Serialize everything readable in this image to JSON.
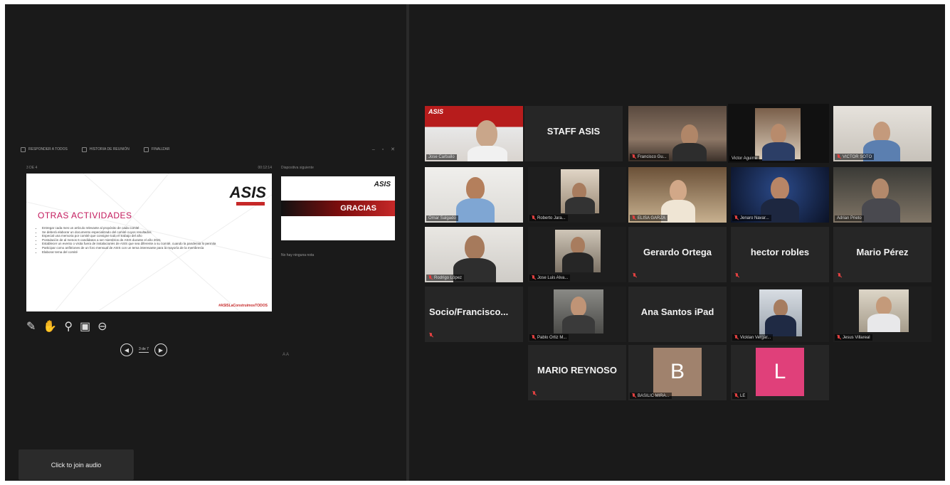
{
  "toolbar": {
    "items": [
      "RESPONDER A TODOS",
      "HISTORIA DE REUNIÓN",
      "FINALIZAR"
    ]
  },
  "slide_panel": {
    "counter": "3 DE 4",
    "timer": "00:12:14",
    "next_label": "Diapositiva siguiente",
    "notes": "No hay ninguna nota",
    "nav_count": "3 de 7"
  },
  "current_slide": {
    "logo": "ASIS",
    "title": "OTRAS ACTIVIDADES",
    "bullets": [
      "Entregar cada mes un artículo relevante al propósito de cada comité",
      "Se deberá elaborar un documento especializado del comité cuyos resultados",
      "Especial una memoria por comité que consigne todo el trabajo del año",
      "Postulación de al menos 6 candidatos a ser miembros de ASIS durante el año 2021",
      "Establecer un evento o visita fuera de instalaciones de ASIS que sea diferente a su comité, cuando la pandemia lo permita",
      "Participar como anfitriones de un foro mensual de ASIS con un tema interesante para la mayoría de la membresía",
      "Elaborar tema del comité"
    ],
    "hashtag": "#ASISLaConstruimosTODOS"
  },
  "next_slide": {
    "logo": "ASIS",
    "title": "GRACIAS"
  },
  "join_audio": "Click to join audio",
  "participants": [
    {
      "name": "Jose Carballo",
      "type": "video"
    },
    {
      "name": "STAFF ASIS",
      "type": "name"
    },
    {
      "name": "Francisco Gu...",
      "type": "video",
      "muted": true
    },
    {
      "name": "Victor Aguirre",
      "type": "video",
      "active": true
    },
    {
      "name": "VICTOR SOTO",
      "type": "video",
      "muted": true
    },
    {
      "name": "Omar Salgado",
      "type": "video"
    },
    {
      "name": "Roberto Jara...",
      "type": "video",
      "muted": true
    },
    {
      "name": "ELISA GARZA",
      "type": "video",
      "muted": true
    },
    {
      "name": "Jenaro Navar...",
      "type": "video",
      "muted": true
    },
    {
      "name": "Adrian Prieto",
      "type": "video"
    },
    {
      "name": "Rodrigo López",
      "type": "video",
      "muted": true
    },
    {
      "name": "Jose Luis Alva...",
      "type": "video",
      "muted": true
    },
    {
      "name": "Gerardo Ortega",
      "type": "name",
      "muted": true
    },
    {
      "name": "hector robles",
      "type": "name",
      "muted": true
    },
    {
      "name": "Mario Pérez",
      "type": "name",
      "muted": true
    },
    {
      "name": "Socio/Francisco...",
      "type": "name",
      "muted": true
    },
    {
      "name": "Pablo Ortiz M...",
      "type": "video",
      "muted": true
    },
    {
      "name": "Ana Santos iPad",
      "type": "name"
    },
    {
      "name": "Vicklan Vergar...",
      "type": "video",
      "muted": true
    },
    {
      "name": "Jesus Villareal",
      "type": "video",
      "muted": true
    },
    {
      "name": "MARIO REYNOSO",
      "type": "name",
      "muted": true
    },
    {
      "name": "BASILIC MIRA...",
      "type": "avatar",
      "initial": "B",
      "muted": true
    },
    {
      "name": "LE",
      "type": "avatar",
      "initial": "L",
      "muted": true
    }
  ],
  "colors": {
    "active_speaker": "#b8d94a",
    "avatar_b": "#a0826d",
    "avatar_l": "#e0407a",
    "brand_red": "#c62828",
    "slide_title": "#c2185b"
  }
}
